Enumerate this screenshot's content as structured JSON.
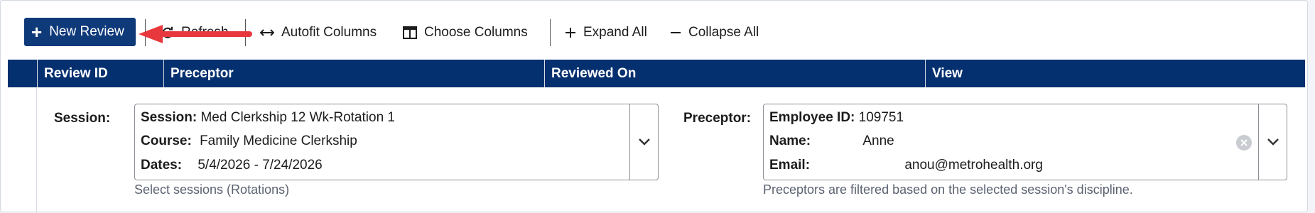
{
  "toolbar": {
    "new_review": "New Review",
    "refresh": "Refresh",
    "autofit": "Autofit Columns",
    "choose_columns": "Choose Columns",
    "expand_all": "Expand All",
    "collapse_all": "Collapse All"
  },
  "table": {
    "columns": [
      "Review ID",
      "Preceptor",
      "Reviewed On",
      "View"
    ]
  },
  "session": {
    "label": "Session:",
    "session_key": "Session:",
    "session_value": "Med Clerkship 12 Wk-Rotation 1",
    "course_key": "Course:",
    "course_value": "Family Medicine Clerkship",
    "dates_key": "Dates:",
    "dates_value": "5/4/2026 - 7/24/2026",
    "hint": "Select sessions (Rotations)"
  },
  "preceptor": {
    "label": "Preceptor:",
    "id_key": "Employee ID:",
    "id_value": "109751",
    "name_key": "Name:",
    "name_value": "Anne",
    "email_key": "Email:",
    "email_value": "anou@metrohealth.org",
    "hint": "Preceptors are filtered based on the selected session's discipline."
  },
  "colors": {
    "primary": "#0f3a7a",
    "header": "#053070",
    "annotation": "#e8383d"
  }
}
